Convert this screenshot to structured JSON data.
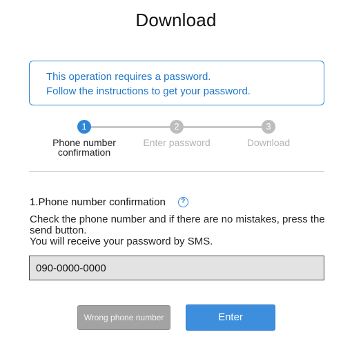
{
  "page": {
    "title": "Download"
  },
  "notice": {
    "line1": "This operation requires a password.",
    "line2": "Follow the instructions to get your password."
  },
  "steps": {
    "items": [
      {
        "number": "1",
        "label": "Phone number confirmation",
        "state": "active"
      },
      {
        "number": "2",
        "label": "Enter password",
        "state": "inactive"
      },
      {
        "number": "3",
        "label": "Download",
        "state": "inactive"
      }
    ]
  },
  "section": {
    "title": "1.Phone number confirmation",
    "help_icon": "question-mark-circle",
    "instruction_line1": "Check the phone number and if there are no mistakes, press the send button.",
    "instruction_line2": "You will receive your password by SMS."
  },
  "phone": {
    "value": "090-0000-0000"
  },
  "buttons": {
    "wrong_label": "Wrong phone number",
    "enter_label": "Enter"
  },
  "colors": {
    "accent": "#2f86d6",
    "button_primary": "#3d8edc",
    "button_secondary": "#a3a3a3",
    "inactive_step": "#bdbdbd"
  }
}
